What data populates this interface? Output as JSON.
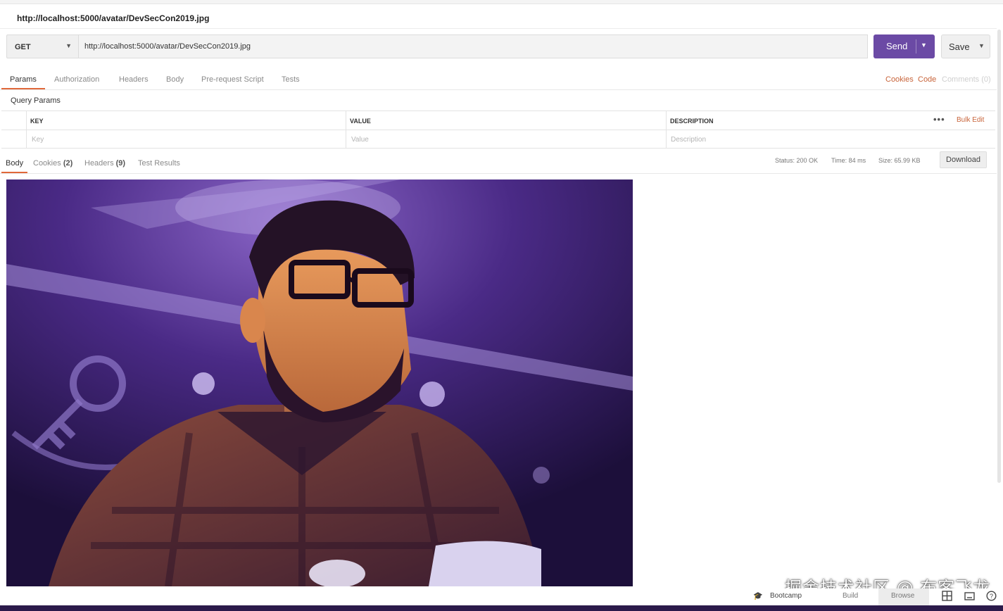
{
  "request": {
    "title": "http://localhost:5000/avatar/DevSecCon2019.jpg",
    "method": "GET",
    "url": "http://localhost:5000/avatar/DevSecCon2019.jpg",
    "send_label": "Send",
    "save_label": "Save"
  },
  "request_tabs": [
    "Params",
    "Authorization",
    "Headers",
    "Body",
    "Pre-request Script",
    "Tests"
  ],
  "right_links": {
    "cookies": "Cookies",
    "code": "Code",
    "comments": "Comments (0)"
  },
  "query_params": {
    "title": "Query Params",
    "columns": [
      "KEY",
      "VALUE",
      "DESCRIPTION"
    ],
    "placeholders": [
      "Key",
      "Value",
      "Description"
    ],
    "bulk_edit": "Bulk Edit"
  },
  "response": {
    "tabs": {
      "body": "Body",
      "cookies": "Cookies",
      "cookies_count": "(2)",
      "headers": "Headers",
      "headers_count": "(9)",
      "test_results": "Test Results"
    },
    "status": "Status: 200 OK",
    "time": "Time: 84 ms",
    "size": "Size: 65.99 KB",
    "download_label": "Download"
  },
  "footer": {
    "bootcamp": "Bootcamp",
    "build": "Build",
    "browse": "Browse"
  },
  "watermark": "掘金技术社区 @ 布客飞龙",
  "colors": {
    "accent": "#e0683a",
    "send": "#6b4aa5",
    "link": "#c8643a"
  }
}
